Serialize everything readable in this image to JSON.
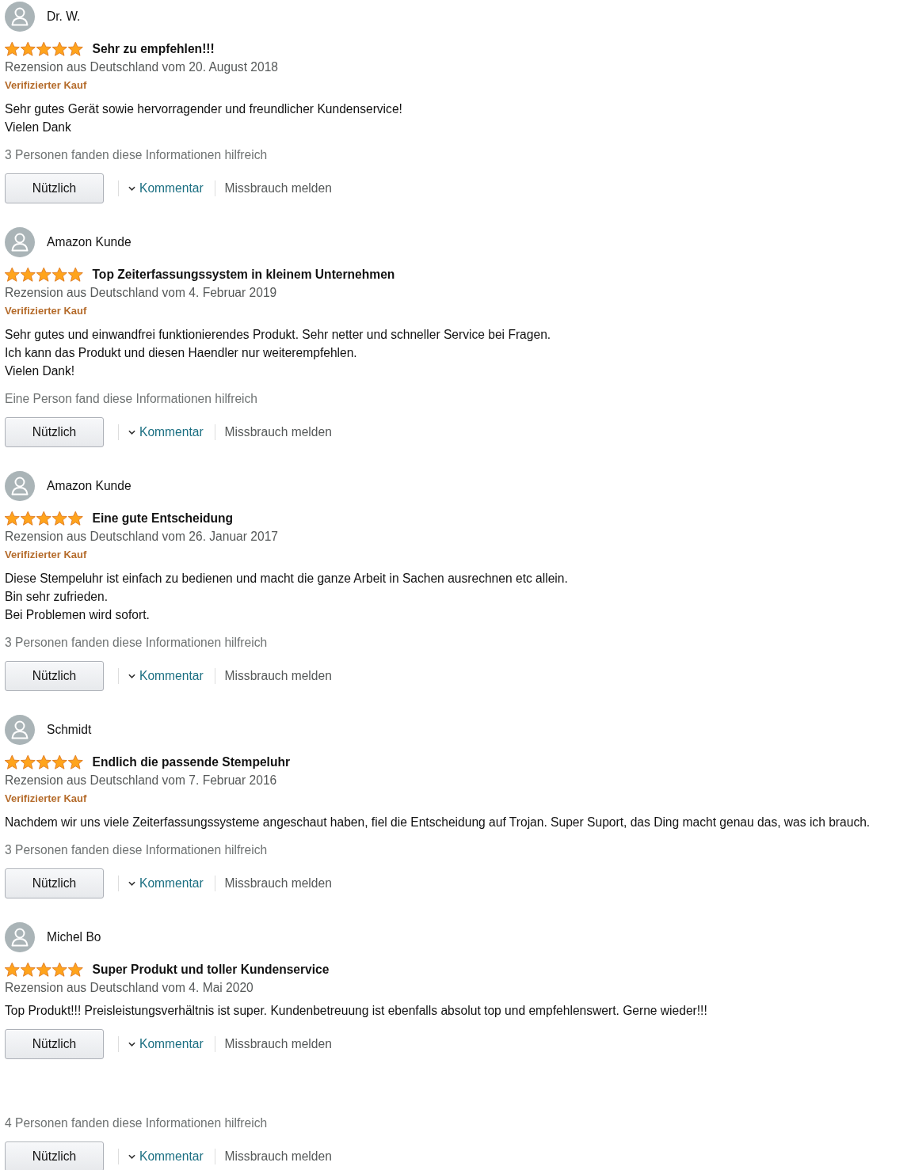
{
  "reviews": [
    {
      "kind": "review",
      "author": "Dr. W.",
      "stars": 5,
      "title": "Sehr zu empfehlen!!!",
      "date": "Rezension aus Deutschland vom 20. August 2018",
      "badge": "Verifizierter Kauf",
      "body": "Sehr gutes Gerät sowie hervorragender und freundlicher Kundenservice!\nVielen Dank",
      "helpful_count": "3 Personen fanden diese Informationen hilfreich",
      "actions": {
        "helpful": "Nützlich",
        "comment": "Kommentar",
        "report": "Missbrauch melden"
      }
    },
    {
      "kind": "review",
      "author": "Amazon Kunde",
      "stars": 5,
      "title": "Top Zeiterfassungssystem in kleinem Unternehmen",
      "date": "Rezension aus Deutschland vom 4. Februar 2019",
      "badge": "Verifizierter Kauf",
      "body": "Sehr gutes und einwandfrei funktionierendes Produkt. Sehr netter und schneller Service bei Fragen.\nIch kann das Produkt und diesen Haendler nur weiterempfehlen.\nVielen Dank!",
      "helpful_count": "Eine Person fand diese Informationen hilfreich",
      "actions": {
        "helpful": "Nützlich",
        "comment": "Kommentar",
        "report": "Missbrauch melden"
      }
    },
    {
      "kind": "review",
      "author": "Amazon Kunde",
      "stars": 5,
      "title": "Eine gute Entscheidung",
      "date": "Rezension aus Deutschland vom 26. Januar 2017",
      "badge": "Verifizierter Kauf",
      "body": "Diese Stempeluhr ist einfach zu bedienen und macht die ganze Arbeit in Sachen ausrechnen etc allein.\nBin sehr zufrieden.\nBei Problemen wird sofort.",
      "helpful_count": "3 Personen fanden diese Informationen hilfreich",
      "actions": {
        "helpful": "Nützlich",
        "comment": "Kommentar",
        "report": "Missbrauch melden"
      }
    },
    {
      "kind": "review",
      "author": "Schmidt",
      "stars": 5,
      "title": "Endlich die passende Stempeluhr",
      "date": "Rezension aus Deutschland vom 7. Februar 2016",
      "badge": "Verifizierter Kauf",
      "body": "Nachdem wir uns viele Zeiterfassungssysteme angeschaut haben, fiel die Entscheidung auf Trojan. Super Suport, das Ding macht genau das, was ich brauch.",
      "helpful_count": "3 Personen fanden diese Informationen hilfreich",
      "actions": {
        "helpful": "Nützlich",
        "comment": "Kommentar",
        "report": "Missbrauch melden"
      }
    },
    {
      "kind": "review",
      "author": "Michel Bo",
      "stars": 5,
      "title": "Super Produkt und toller Kundenservice",
      "date": "Rezension aus Deutschland vom 4. Mai 2020",
      "body": "Top Produkt!!! Preisleistungsverhältnis ist super. Kundenbetreuung ist ebenfalls absolut top und empfehlenswert. Gerne wieder!!!",
      "actions": {
        "helpful": "Nützlich",
        "comment": "Kommentar",
        "report": "Missbrauch melden"
      }
    },
    {
      "kind": "feedback",
      "helpful_count": "4 Personen fanden diese Informationen hilfreich",
      "actions": {
        "helpful": "Nützlich",
        "comment": "Kommentar",
        "report": "Missbrauch melden"
      }
    }
  ]
}
